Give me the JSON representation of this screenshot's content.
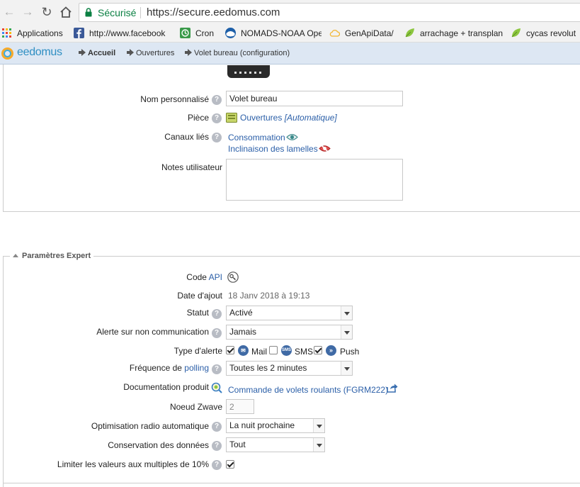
{
  "browser": {
    "secure_label": "Sécurisé",
    "url": "https://secure.eedomus.com",
    "bookmarks": [
      {
        "label": "Applications",
        "icon": "apps-grid-icon"
      },
      {
        "label": "http://www.facebook",
        "icon": "facebook-icon"
      },
      {
        "label": "Cron",
        "icon": "cron-icon"
      },
      {
        "label": "NOMADS-NOAA Ope",
        "icon": "noaa-icon"
      },
      {
        "label": "GenApiData/",
        "icon": "cloud-icon"
      },
      {
        "label": "arrachage + transplan",
        "icon": "leaf-icon"
      },
      {
        "label": "cycas revolut",
        "icon": "leaf-icon"
      }
    ]
  },
  "app": {
    "logo_text": "eedomus",
    "breadcrumb": [
      "Accueil",
      "Ouvertures",
      "Volet bureau (configuration)"
    ]
  },
  "general": {
    "name_label": "Nom personnalisé",
    "name_value": "Volet bureau",
    "room_label": "Pièce",
    "room_value": "Ouvertures",
    "room_suffix": "[Automatique]",
    "channels_label": "Canaux liés",
    "channels": [
      "Consommation",
      "Inclinaison des lamelles"
    ],
    "notes_label": "Notes utilisateur"
  },
  "expert": {
    "title": "Paramètres Expert",
    "api_label": "Code",
    "api_link": "API",
    "date_label": "Date d'ajout",
    "date_value": "18 Janv 2018 à 19:13",
    "status_label": "Statut",
    "status_value": "Activé",
    "alert_label": "Alerte sur non communication",
    "alert_value": "Jamais",
    "alert_type_label": "Type d'alerte",
    "alert_mail": "Mail",
    "alert_sms": "SMS",
    "alert_push": "Push",
    "alert_mail_checked": true,
    "alert_sms_checked": false,
    "alert_push_checked": true,
    "polling_label": "Fréquence de",
    "polling_link": "polling",
    "polling_value": "Toutes les 2 minutes",
    "doc_label": "Documentation produit",
    "doc_value": "Commande de volets roulants (FGRM222)",
    "node_label": "Noeud Zwave",
    "node_value": "2",
    "radio_label": "Optimisation radio automatique",
    "radio_value": "La nuit prochaine",
    "retention_label": "Conservation des données",
    "retention_value": "Tout",
    "limit_label": "Limiter les valeurs aux multiples de 10%",
    "limit_checked": true
  },
  "colors": {
    "secure_green": "#0b8043",
    "link_blue": "#2b5fa8",
    "header_bg": "#dde7f3"
  }
}
